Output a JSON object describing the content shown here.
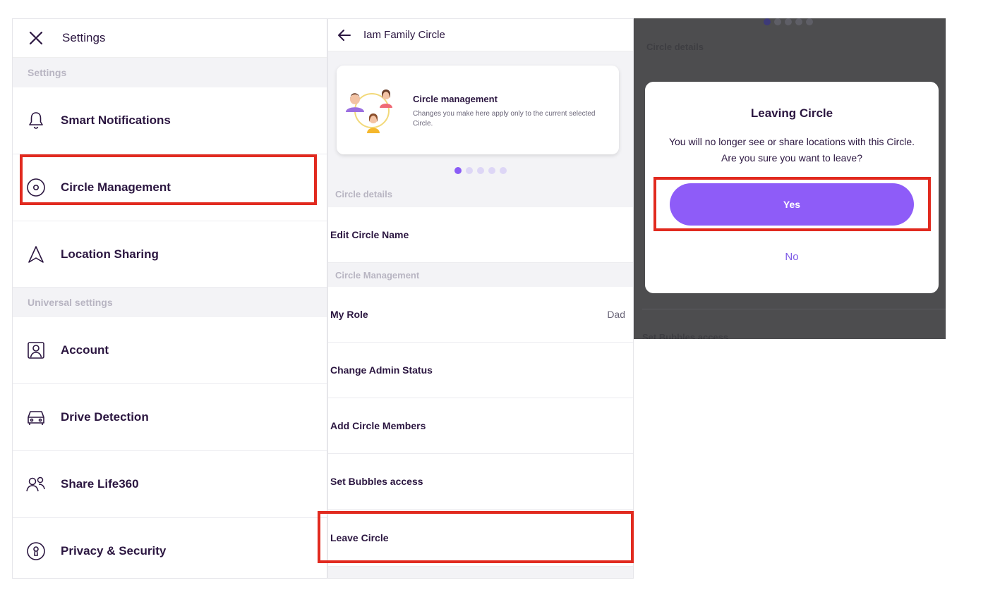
{
  "settings_panel": {
    "title": "Settings",
    "section_settings": "Settings",
    "section_universal": "Universal settings",
    "items": [
      {
        "label": "Smart Notifications",
        "icon": "bell-icon"
      },
      {
        "label": "Circle Management",
        "icon": "circle-icon"
      },
      {
        "label": "Location Sharing",
        "icon": "navigation-icon"
      },
      {
        "label": "Account",
        "icon": "account-icon"
      },
      {
        "label": "Drive Detection",
        "icon": "car-icon"
      },
      {
        "label": "Share Life360",
        "icon": "share-users-icon"
      },
      {
        "label": "Privacy & Security",
        "icon": "keyhole-icon"
      }
    ]
  },
  "circle_panel": {
    "title": "Iam Family Circle",
    "card": {
      "title": "Circle management",
      "description": "Changes you make here apply only to the current selected Circle."
    },
    "carousel": {
      "count": 5,
      "active": 0
    },
    "section_details": "Circle details",
    "section_management": "Circle Management",
    "edit_name": "Edit Circle Name",
    "rows": [
      {
        "label": "My Role",
        "value": "Dad"
      },
      {
        "label": "Change Admin Status",
        "value": ""
      },
      {
        "label": "Add Circle Members",
        "value": ""
      },
      {
        "label": "Set Bubbles access",
        "value": ""
      },
      {
        "label": "Leave Circle",
        "value": ""
      }
    ]
  },
  "dialog_panel": {
    "bg_section": "Circle details",
    "bg_bottom": "Set Bubbles access",
    "title": "Leaving Circle",
    "message_line1": "You will no longer see or share locations with this Circle.",
    "message_line2": "Are you sure you want to leave?",
    "yes_label": "Yes",
    "no_label": "No"
  },
  "colors": {
    "accent": "#8e5cf6",
    "highlight": "#e12a1f",
    "text": "#2b1640"
  }
}
